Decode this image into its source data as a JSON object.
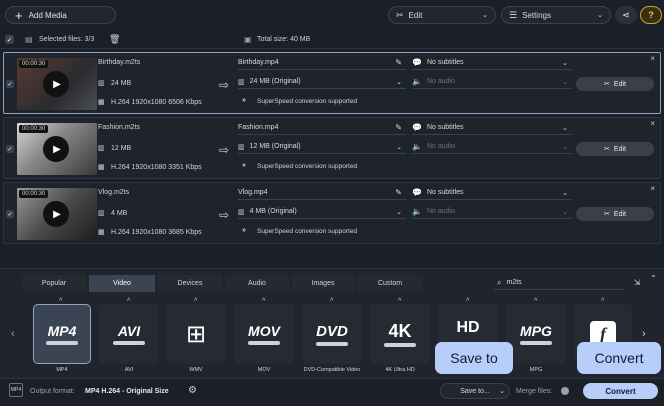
{
  "toolbar": {
    "add_media": "Add Media",
    "edit": "Edit",
    "settings": "Settings"
  },
  "status": {
    "selected_files": "Selected files: 3/3",
    "total_size": "Total size: 40 MB"
  },
  "files": [
    {
      "duration": "00:00:30",
      "src_name": "Birthday.m2ts",
      "src_size": "24 MB",
      "src_info": "H.264 1920x1080 6506 Kbps",
      "out_name": "Birthday.mp4",
      "out_size": "24 MB (Original)",
      "superspeed": "SuperSpeed conversion supported",
      "subtitles": "No subtitles",
      "audio": "No audio",
      "edit_label": "Edit",
      "selected": true
    },
    {
      "duration": "00:00:30",
      "src_name": "Fashion.m2ts",
      "src_size": "12 MB",
      "src_info": "H.264 1920x1080 3351 Kbps",
      "out_name": "Fashion.mp4",
      "out_size": "12 MB (Original)",
      "superspeed": "SuperSpeed conversion supported",
      "subtitles": "No subtitles",
      "audio": "No audio",
      "edit_label": "Edit",
      "selected": false
    },
    {
      "duration": "00:00:30",
      "src_name": "Vlog.m2ts",
      "src_size": "4 MB",
      "src_info": "H.264 1920x1080 3685 Kbps",
      "out_name": "Vlog.mp4",
      "out_size": "4 MB (Original)",
      "superspeed": "SuperSpeed conversion supported",
      "subtitles": "No subtitles",
      "audio": "No audio",
      "edit_label": "Edit",
      "selected": false
    }
  ],
  "tabs": [
    "Popular",
    "Video",
    "Devices",
    "Audio",
    "Images",
    "Custom"
  ],
  "active_tab": "Video",
  "search": {
    "value": "m2ts"
  },
  "formats": [
    {
      "logo": "MP4",
      "label": "MP4"
    },
    {
      "logo": "AVI",
      "label": "AVI"
    },
    {
      "logo": "WMV",
      "label": "WMV"
    },
    {
      "logo": "MOV",
      "label": "MOV"
    },
    {
      "logo": "DVD",
      "label": "DVD-Compatible Video"
    },
    {
      "logo": "4K",
      "label": "4K Ultra HD"
    },
    {
      "logo": "HD",
      "label": ""
    },
    {
      "logo": "MPG",
      "label": "MPG"
    },
    {
      "logo": "f",
      "label": ""
    }
  ],
  "bottom": {
    "output_format_label": "Output format:",
    "output_format_value": "MP4 H.264 - Original Size",
    "save_to": "Save to...",
    "merge_files": "Merge files:",
    "convert": "Convert"
  },
  "tooltips": {
    "save_to": "Save to",
    "convert": "Convert"
  },
  "colors": {
    "accent": "#b7cdfa",
    "background": "#1b1f27",
    "selected_border": "#8ea4c8"
  }
}
